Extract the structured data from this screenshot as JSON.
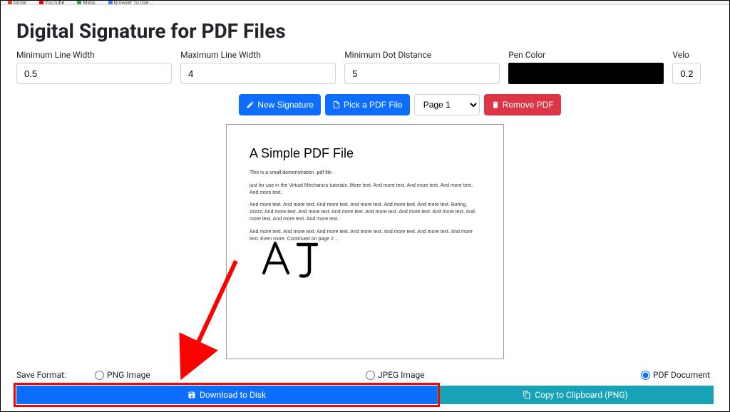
{
  "bookmarks": [
    "Gmail",
    "YouTube",
    "Maps",
    "Browser To Use ..."
  ],
  "title": "Digital Signature for PDF Files",
  "fields": {
    "minLineWidth": {
      "label": "Minimum Line Width",
      "value": "0.5"
    },
    "maxLineWidth": {
      "label": "Maximum Line Width",
      "value": "4"
    },
    "minDotDistance": {
      "label": "Minimum Dot Distance",
      "value": "5"
    },
    "penColor": {
      "label": "Pen Color",
      "value": "#000000"
    },
    "velocity": {
      "label": "Velo",
      "value": "0.2"
    }
  },
  "toolbar": {
    "newSignature": "New Signature",
    "pickPdf": "Pick a PDF File",
    "pageSelect": "Page 1",
    "removePdf": "Remove PDF"
  },
  "pdf": {
    "title": "A Simple PDF File",
    "p1": "This is a small demonstration .pdf file -",
    "p2": "just for use in the Virtual Mechanics tutorials. More text. And more text. And more text. And more text. And more text.",
    "p3": "And more text. And more text. And more text. And more text. And more text. And more text. Boring, zzzzz. And more text. And more text. And more text. And more text. And more text. And more text. And more text. And more text. And more text.",
    "p4": "And more text. And more text. And more text. And more text. And more text. And more text. And more text. Even more. Continued on page 2 ..."
  },
  "saveRow": {
    "label": "Save Format:",
    "png": "PNG Image",
    "jpeg": "JPEG Image",
    "pdf": "PDF Document"
  },
  "buttons": {
    "download": "Download to Disk",
    "copy": "Copy to Clipboard (PNG)"
  }
}
